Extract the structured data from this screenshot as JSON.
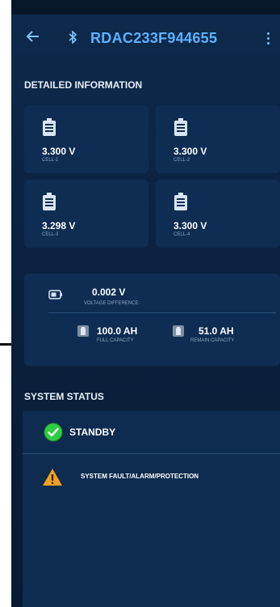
{
  "device": {
    "name": "RDAC233F944655"
  },
  "sections": {
    "detailed": "DETAILED INFORMATION",
    "system": "SYSTEM STATUS"
  },
  "cells": [
    {
      "value": "3.300 V",
      "label": "CELL-1"
    },
    {
      "value": "3.300 V",
      "label": "CELL-2"
    },
    {
      "value": "3.298 V",
      "label": "CELL-3"
    },
    {
      "value": "3.300 V",
      "label": "CELL-4"
    }
  ],
  "summary": {
    "voltage_diff": {
      "value": "0.002 V",
      "label": "VOLTAGE DIFFERENCE:"
    },
    "full_capacity": {
      "value": "100.0 AH",
      "label": "FULL CAPACITY"
    },
    "remain_capacity": {
      "value": "51.0 AH",
      "label": "REMAIN CAPACITY"
    }
  },
  "status": {
    "standby": "STANDBY",
    "fault": "SYSTEM FAULT/ALARM/PROTECTION"
  },
  "colors": {
    "accent": "#5bb2ff",
    "ok_green": "#2ecc40",
    "warn_orange": "#f0a020"
  }
}
